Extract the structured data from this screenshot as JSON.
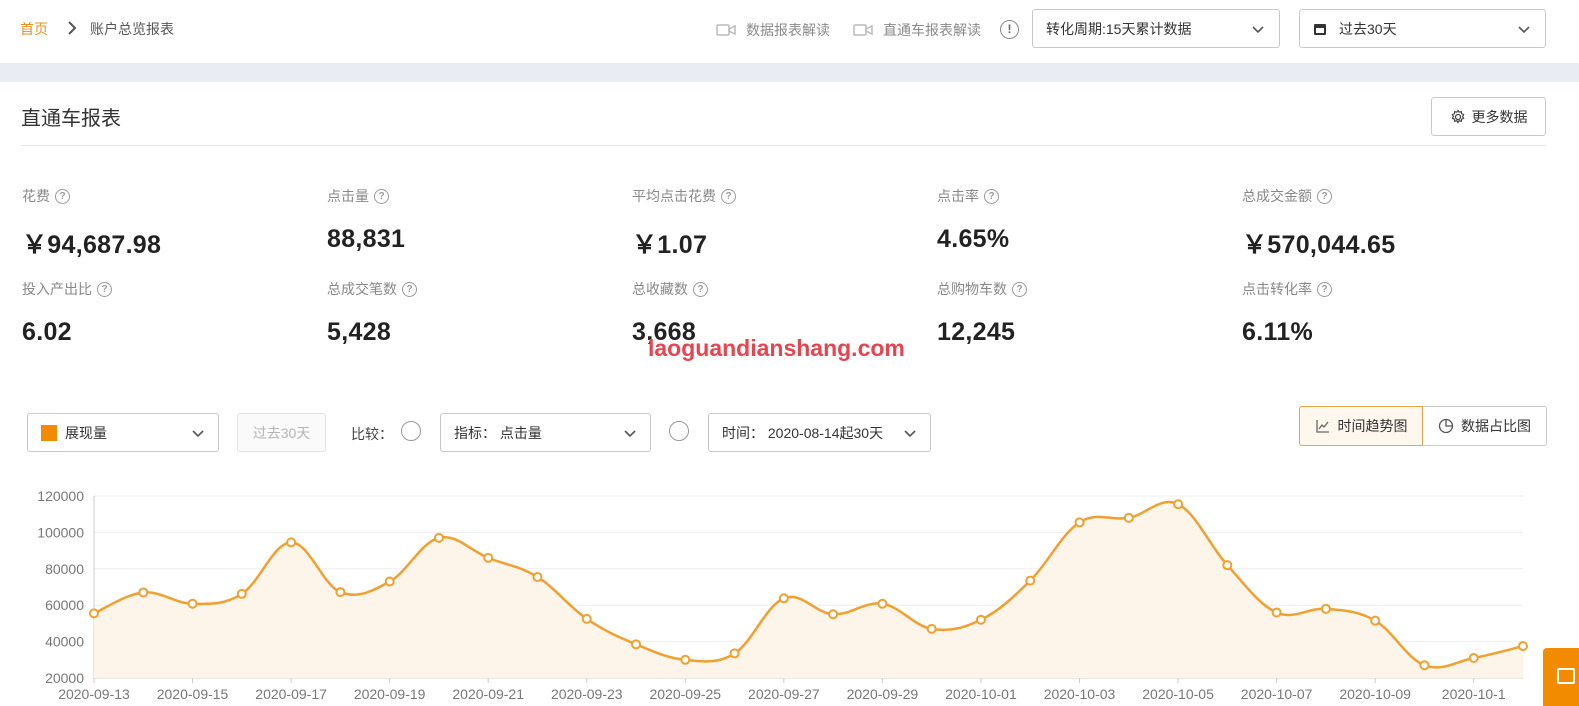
{
  "breadcrumb": {
    "home": "首页",
    "current": "账户总览报表"
  },
  "header": {
    "video_links": [
      "数据报表解读",
      "直通车报表解读"
    ],
    "period_select": "转化周期:15天累计数据",
    "date_select": "过去30天"
  },
  "report": {
    "title": "直通车报表",
    "more_button": "更多数据"
  },
  "metrics": [
    {
      "label": "花费",
      "value": "￥94,687.98"
    },
    {
      "label": "点击量",
      "value": "88,831"
    },
    {
      "label": "平均点击花费",
      "value": "￥1.07"
    },
    {
      "label": "点击率",
      "value": "4.65%"
    },
    {
      "label": "总成交金额",
      "value": "￥570,044.65"
    },
    {
      "label": "投入产出比",
      "value": "6.02"
    },
    {
      "label": "总成交笔数",
      "value": "5,428"
    },
    {
      "label": "总收藏数",
      "value": "3,668"
    },
    {
      "label": "总购物车数",
      "value": "12,245"
    },
    {
      "label": "点击转化率",
      "value": "6.11%"
    }
  ],
  "watermark": "laoguandianshang.com",
  "controls": {
    "metric_select": "展现量",
    "metric_color": "#f28b00",
    "range_button": "过去30天",
    "compare_label": "比较：",
    "indicator_select": "指标： 点击量",
    "time_select": "时间： 2020-08-14起30天",
    "view_trend": "时间趋势图",
    "view_share": "数据占比图"
  },
  "colors": {
    "accent": "#e8901e",
    "line": "#f0a030",
    "area": "#fdf5e9"
  },
  "chart_data": {
    "type": "area",
    "series": [
      {
        "values": [
          55500,
          67000,
          60800,
          66200,
          94500,
          67200,
          73000,
          97000,
          86000,
          75500,
          52500,
          38500,
          30000,
          33500,
          63800,
          55000,
          60800,
          47000,
          52000,
          73500,
          105500,
          108000,
          115500,
          82000,
          56000,
          58000,
          51500,
          27000,
          31000,
          37500
        ]
      }
    ],
    "x": [
      "2020-09-13",
      "2020-09-14",
      "2020-09-15",
      "2020-09-16",
      "2020-09-17",
      "2020-09-18",
      "2020-09-19",
      "2020-09-20",
      "2020-09-21",
      "2020-09-22",
      "2020-09-23",
      "2020-09-24",
      "2020-09-25",
      "2020-09-26",
      "2020-09-27",
      "2020-09-28",
      "2020-09-29",
      "2020-09-30",
      "2020-10-01",
      "2020-10-02",
      "2020-10-03",
      "2020-10-04",
      "2020-10-05",
      "2020-10-06",
      "2020-10-07",
      "2020-10-08",
      "2020-10-09",
      "2020-10-10",
      "2020-10-11",
      "2020-10-12"
    ],
    "x_tick_labels": [
      "2020-09-13",
      "2020-09-15",
      "2020-09-17",
      "2020-09-19",
      "2020-09-21",
      "2020-09-23",
      "2020-09-25",
      "2020-09-27",
      "2020-09-29",
      "2020-10-01",
      "2020-10-03",
      "2020-10-05",
      "2020-10-07",
      "2020-10-09",
      "2020-10-1"
    ],
    "y_ticks": [
      20000,
      40000,
      60000,
      80000,
      100000,
      120000
    ],
    "ylim": [
      20000,
      120000
    ],
    "grid": true
  }
}
